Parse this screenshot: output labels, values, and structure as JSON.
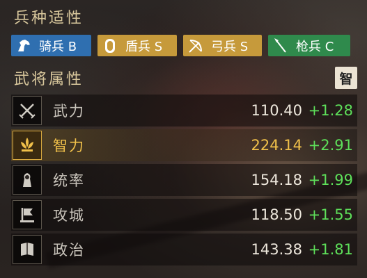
{
  "troop_affinity": {
    "title": "兵种适性",
    "items": [
      {
        "label": "骑兵 B",
        "icon": "horse-icon",
        "color": "#2f6fb0"
      },
      {
        "label": "盾兵 S",
        "icon": "shield-icon",
        "color": "#c69a3b"
      },
      {
        "label": "弓兵 S",
        "icon": "bow-icon",
        "color": "#c69a3b"
      },
      {
        "label": "枪兵 C",
        "icon": "spear-icon",
        "color": "#2f8a4c"
      }
    ]
  },
  "general_attributes": {
    "title": "武将属性",
    "badge": "智",
    "rows": [
      {
        "label": "武力",
        "value": "110.40",
        "bonus": "+1.28",
        "icon": "swords-icon"
      },
      {
        "label": "智力",
        "value": "224.14",
        "bonus": "+2.91",
        "icon": "lotus-icon"
      },
      {
        "label": "统率",
        "value": "154.18",
        "bonus": "+1.99",
        "icon": "command-icon"
      },
      {
        "label": "攻城",
        "value": "118.50",
        "bonus": "+1.55",
        "icon": "flag-icon"
      },
      {
        "label": "政治",
        "value": "143.38",
        "bonus": "+1.81",
        "icon": "book-icon"
      }
    ]
  },
  "colors": {
    "highlight": "#f0c04a",
    "bonus": "#5ee05a",
    "title": "#d8c79c"
  }
}
